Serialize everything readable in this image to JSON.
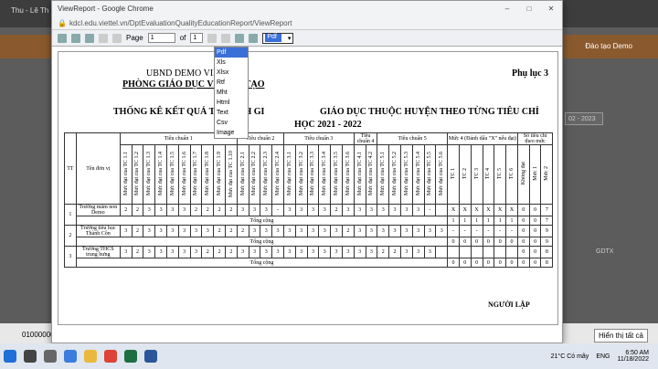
{
  "bg": {
    "tab1": "Thu - Lê Th",
    "user_link": "Đào tạo Demo",
    "year": "02 - 2023",
    "right_label": "GDTX",
    "notice": "Hiển thị tất cả",
    "left_code": "01000000"
  },
  "popup": {
    "title": "ViewReport - Google Chrome",
    "url": "kdcl.edu.viettel.vn/DptEvaluationQualityEducationReport/ViewReport"
  },
  "toolbar": {
    "page_label": "Page",
    "page_value": "1",
    "of_label": "of",
    "total_pages": "1",
    "format_value": "Pdf"
  },
  "formats": [
    "Pdf",
    "Xls",
    "Xlsx",
    "Rtf",
    "Mht",
    "Html",
    "Text",
    "Csv",
    "Image"
  ],
  "report": {
    "org1": "UBND DEMO VIETTEL",
    "org2": "PHÒNG GIÁO DỤC VÀ ĐÀO TẠO",
    "appendix": "Phụ lục 3",
    "title1": "THỐNG KÊ KẾT QUẢ TỰ ĐÁNH GI",
    "title2": "GIÁO DỤC THUỘC HUYỆN THEO TỪNG TIÊU CHÍ",
    "title3": "HỌC 2021 - 2022",
    "col_tt": "TT",
    "col_unit": "Tên đơn vị",
    "groups": [
      "Tiêu chuẩn 1",
      "Tiêu chuẩn 2",
      "Tiêu chuẩn 3",
      "Tiêu chuẩn 4",
      "Tiêu chuẩn 5",
      "Mức 4 (Đánh dấu \"X\" nếu đạt)",
      "Số tiêu chí theo mức"
    ],
    "subs": [
      "Mức đạt của TC 1.1",
      "Mức đạt của TC 1.2",
      "Mức đạt của TC 1.3",
      "Mức đạt của TC 1.4",
      "Mức đạt của TC 1.5",
      "Mức đạt của TC 1.6",
      "Mức đạt của TC 1.7",
      "Mức đạt của TC 1.8",
      "Mức đạt của TC 1.9",
      "Mức đạt của TC 1.10",
      "Mức đạt của TC 2.1",
      "Mức đạt của TC 2.2",
      "Mức đạt của TC 2.3",
      "Mức đạt của TC 2.4",
      "Mức đạt của TC 3.1",
      "Mức đạt của TC 3.2",
      "Mức đạt của TC 3.3",
      "Mức đạt của TC 3.4",
      "Mức đạt của TC 3.5",
      "Mức đạt của TC 3.6",
      "Mức đạt của TC 4.1",
      "Mức đạt của TC 4.2",
      "Mức đạt của TC 5.1",
      "Mức đạt của TC 5.2",
      "Mức đạt của TC 5.3",
      "Mức đạt của TC 5.4",
      "Mức đạt của TC 5.5",
      "Mức đạt của TC 5.6",
      "TC 1",
      "TC 2",
      "TC 3",
      "TC 4",
      "TC 5",
      "TC 6",
      "Không đạt",
      "Mức 1",
      "Mức 2"
    ],
    "rows": [
      {
        "tt": "1",
        "name": "Trường mầm non Demo",
        "vals": [
          "2",
          "2",
          "3",
          "3",
          "3",
          "3",
          "2",
          "2",
          "2",
          "2",
          "3",
          "3",
          "3",
          "-",
          "3",
          "3",
          "3",
          "3",
          "2",
          "3",
          "3",
          "3",
          "3",
          "3",
          "3",
          "3",
          "-",
          "",
          "X",
          "X",
          "X",
          "X",
          "X",
          "X",
          "0",
          "0",
          "7"
        ],
        "total": [
          "",
          "",
          "",
          "",
          "",
          "",
          "",
          "",
          "",
          "",
          "",
          "",
          "",
          "",
          "",
          "",
          "",
          "",
          "",
          "",
          "",
          "",
          "",
          "",
          "",
          "",
          "",
          "",
          "1",
          "1",
          "1",
          "1",
          "1",
          "1",
          "0",
          "0",
          "7"
        ]
      },
      {
        "tt": "2",
        "name": "Trường tiểu học Thành Côn",
        "vals": [
          "3",
          "2",
          "3",
          "3",
          "3",
          "3",
          "3",
          "3",
          "2",
          "2",
          "2",
          "3",
          "3",
          "3",
          "3",
          "3",
          "3",
          "3",
          "3",
          "2",
          "3",
          "3",
          "3",
          "3",
          "3",
          "3",
          "3",
          "3",
          "-",
          "-",
          "-",
          "-",
          "-",
          "-",
          "0",
          "0",
          "9"
        ],
        "total": [
          "",
          "",
          "",
          "",
          "",
          "",
          "",
          "",
          "",
          "",
          "",
          "",
          "",
          "",
          "",
          "",
          "",
          "",
          "",
          "",
          "",
          "",
          "",
          "",
          "",
          "",
          "",
          "",
          "0",
          "0",
          "0",
          "0",
          "0",
          "0",
          "0",
          "0",
          "9"
        ]
      },
      {
        "tt": "3",
        "name": "Trường THCS trung hưng",
        "vals": [
          "3",
          "2",
          "3",
          "3",
          "3",
          "3",
          "3",
          "2",
          "2",
          "2",
          "3",
          "3",
          "3",
          "3",
          "3",
          "3",
          "3",
          "3",
          "3",
          "3",
          "3",
          "3",
          "2",
          "2",
          "3",
          "3",
          "3",
          "",
          "",
          "",
          "",
          "",
          "",
          "",
          "0",
          "0",
          "8"
        ],
        "total": [
          "",
          "",
          "",
          "",
          "",
          "",
          "",
          "",
          "",
          "",
          "",
          "",
          "",
          "",
          "",
          "",
          "",
          "",
          "",
          "",
          "",
          "",
          "",
          "",
          "",
          "",
          "",
          "",
          "0",
          "0",
          "0",
          "0",
          "0",
          "0",
          "0",
          "0",
          "8"
        ]
      }
    ],
    "total_label": "Tổng cộng",
    "signer": "NGƯỜI LẬP"
  },
  "taskbar": {
    "weather": "21°C Có mây",
    "lang": "ENG",
    "time": "6:50 AM",
    "date": "11/18/2022"
  }
}
